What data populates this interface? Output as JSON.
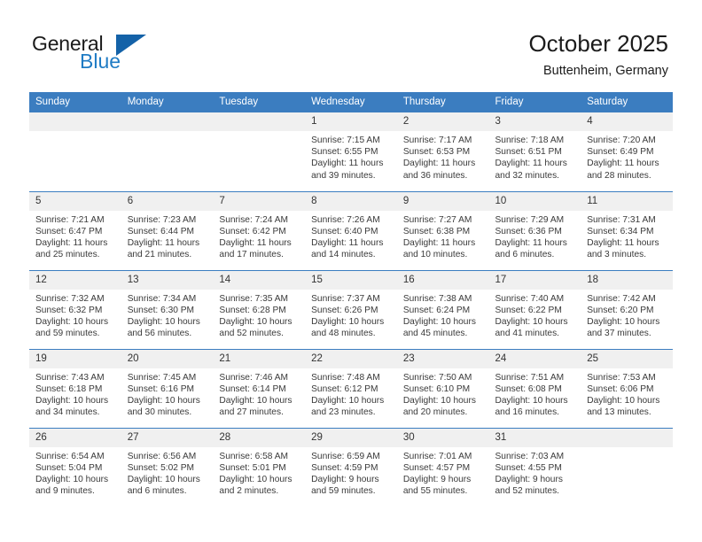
{
  "branding": {
    "logo_text_primary": "General",
    "logo_text_secondary": "Blue",
    "triangle_color": "#1462a8",
    "blue_color": "#1f7bc4"
  },
  "header": {
    "month_title": "October 2025",
    "location": "Buttenheim, Germany"
  },
  "theme": {
    "header_bg": "#3b7dc0",
    "header_text": "#ffffff",
    "daynum_bg": "#f0f0f0",
    "cell_bg": "#ffffff",
    "body_text": "#3a3a3a"
  },
  "weekdays": [
    "Sunday",
    "Monday",
    "Tuesday",
    "Wednesday",
    "Thursday",
    "Friday",
    "Saturday"
  ],
  "labels": {
    "sunrise_prefix": "Sunrise:",
    "sunset_prefix": "Sunset:",
    "daylight_prefix": "Daylight:"
  },
  "weeks": [
    [
      {
        "day": "",
        "empty": true,
        "l1": "",
        "l2": "",
        "l3": "",
        "l4": ""
      },
      {
        "day": "",
        "empty": true,
        "l1": "",
        "l2": "",
        "l3": "",
        "l4": ""
      },
      {
        "day": "",
        "empty": true,
        "l1": "",
        "l2": "",
        "l3": "",
        "l4": ""
      },
      {
        "day": "1",
        "empty": false,
        "l1": "Sunrise: 7:15 AM",
        "l2": "Sunset: 6:55 PM",
        "l3": "Daylight: 11 hours",
        "l4": "and 39 minutes."
      },
      {
        "day": "2",
        "empty": false,
        "l1": "Sunrise: 7:17 AM",
        "l2": "Sunset: 6:53 PM",
        "l3": "Daylight: 11 hours",
        "l4": "and 36 minutes."
      },
      {
        "day": "3",
        "empty": false,
        "l1": "Sunrise: 7:18 AM",
        "l2": "Sunset: 6:51 PM",
        "l3": "Daylight: 11 hours",
        "l4": "and 32 minutes."
      },
      {
        "day": "4",
        "empty": false,
        "l1": "Sunrise: 7:20 AM",
        "l2": "Sunset: 6:49 PM",
        "l3": "Daylight: 11 hours",
        "l4": "and 28 minutes."
      }
    ],
    [
      {
        "day": "5",
        "empty": false,
        "l1": "Sunrise: 7:21 AM",
        "l2": "Sunset: 6:47 PM",
        "l3": "Daylight: 11 hours",
        "l4": "and 25 minutes."
      },
      {
        "day": "6",
        "empty": false,
        "l1": "Sunrise: 7:23 AM",
        "l2": "Sunset: 6:44 PM",
        "l3": "Daylight: 11 hours",
        "l4": "and 21 minutes."
      },
      {
        "day": "7",
        "empty": false,
        "l1": "Sunrise: 7:24 AM",
        "l2": "Sunset: 6:42 PM",
        "l3": "Daylight: 11 hours",
        "l4": "and 17 minutes."
      },
      {
        "day": "8",
        "empty": false,
        "l1": "Sunrise: 7:26 AM",
        "l2": "Sunset: 6:40 PM",
        "l3": "Daylight: 11 hours",
        "l4": "and 14 minutes."
      },
      {
        "day": "9",
        "empty": false,
        "l1": "Sunrise: 7:27 AM",
        "l2": "Sunset: 6:38 PM",
        "l3": "Daylight: 11 hours",
        "l4": "and 10 minutes."
      },
      {
        "day": "10",
        "empty": false,
        "l1": "Sunrise: 7:29 AM",
        "l2": "Sunset: 6:36 PM",
        "l3": "Daylight: 11 hours",
        "l4": "and 6 minutes."
      },
      {
        "day": "11",
        "empty": false,
        "l1": "Sunrise: 7:31 AM",
        "l2": "Sunset: 6:34 PM",
        "l3": "Daylight: 11 hours",
        "l4": "and 3 minutes."
      }
    ],
    [
      {
        "day": "12",
        "empty": false,
        "l1": "Sunrise: 7:32 AM",
        "l2": "Sunset: 6:32 PM",
        "l3": "Daylight: 10 hours",
        "l4": "and 59 minutes."
      },
      {
        "day": "13",
        "empty": false,
        "l1": "Sunrise: 7:34 AM",
        "l2": "Sunset: 6:30 PM",
        "l3": "Daylight: 10 hours",
        "l4": "and 56 minutes."
      },
      {
        "day": "14",
        "empty": false,
        "l1": "Sunrise: 7:35 AM",
        "l2": "Sunset: 6:28 PM",
        "l3": "Daylight: 10 hours",
        "l4": "and 52 minutes."
      },
      {
        "day": "15",
        "empty": false,
        "l1": "Sunrise: 7:37 AM",
        "l2": "Sunset: 6:26 PM",
        "l3": "Daylight: 10 hours",
        "l4": "and 48 minutes."
      },
      {
        "day": "16",
        "empty": false,
        "l1": "Sunrise: 7:38 AM",
        "l2": "Sunset: 6:24 PM",
        "l3": "Daylight: 10 hours",
        "l4": "and 45 minutes."
      },
      {
        "day": "17",
        "empty": false,
        "l1": "Sunrise: 7:40 AM",
        "l2": "Sunset: 6:22 PM",
        "l3": "Daylight: 10 hours",
        "l4": "and 41 minutes."
      },
      {
        "day": "18",
        "empty": false,
        "l1": "Sunrise: 7:42 AM",
        "l2": "Sunset: 6:20 PM",
        "l3": "Daylight: 10 hours",
        "l4": "and 37 minutes."
      }
    ],
    [
      {
        "day": "19",
        "empty": false,
        "l1": "Sunrise: 7:43 AM",
        "l2": "Sunset: 6:18 PM",
        "l3": "Daylight: 10 hours",
        "l4": "and 34 minutes."
      },
      {
        "day": "20",
        "empty": false,
        "l1": "Sunrise: 7:45 AM",
        "l2": "Sunset: 6:16 PM",
        "l3": "Daylight: 10 hours",
        "l4": "and 30 minutes."
      },
      {
        "day": "21",
        "empty": false,
        "l1": "Sunrise: 7:46 AM",
        "l2": "Sunset: 6:14 PM",
        "l3": "Daylight: 10 hours",
        "l4": "and 27 minutes."
      },
      {
        "day": "22",
        "empty": false,
        "l1": "Sunrise: 7:48 AM",
        "l2": "Sunset: 6:12 PM",
        "l3": "Daylight: 10 hours",
        "l4": "and 23 minutes."
      },
      {
        "day": "23",
        "empty": false,
        "l1": "Sunrise: 7:50 AM",
        "l2": "Sunset: 6:10 PM",
        "l3": "Daylight: 10 hours",
        "l4": "and 20 minutes."
      },
      {
        "day": "24",
        "empty": false,
        "l1": "Sunrise: 7:51 AM",
        "l2": "Sunset: 6:08 PM",
        "l3": "Daylight: 10 hours",
        "l4": "and 16 minutes."
      },
      {
        "day": "25",
        "empty": false,
        "l1": "Sunrise: 7:53 AM",
        "l2": "Sunset: 6:06 PM",
        "l3": "Daylight: 10 hours",
        "l4": "and 13 minutes."
      }
    ],
    [
      {
        "day": "26",
        "empty": false,
        "l1": "Sunrise: 6:54 AM",
        "l2": "Sunset: 5:04 PM",
        "l3": "Daylight: 10 hours",
        "l4": "and 9 minutes."
      },
      {
        "day": "27",
        "empty": false,
        "l1": "Sunrise: 6:56 AM",
        "l2": "Sunset: 5:02 PM",
        "l3": "Daylight: 10 hours",
        "l4": "and 6 minutes."
      },
      {
        "day": "28",
        "empty": false,
        "l1": "Sunrise: 6:58 AM",
        "l2": "Sunset: 5:01 PM",
        "l3": "Daylight: 10 hours",
        "l4": "and 2 minutes."
      },
      {
        "day": "29",
        "empty": false,
        "l1": "Sunrise: 6:59 AM",
        "l2": "Sunset: 4:59 PM",
        "l3": "Daylight: 9 hours",
        "l4": "and 59 minutes."
      },
      {
        "day": "30",
        "empty": false,
        "l1": "Sunrise: 7:01 AM",
        "l2": "Sunset: 4:57 PM",
        "l3": "Daylight: 9 hours",
        "l4": "and 55 minutes."
      },
      {
        "day": "31",
        "empty": false,
        "l1": "Sunrise: 7:03 AM",
        "l2": "Sunset: 4:55 PM",
        "l3": "Daylight: 9 hours",
        "l4": "and 52 minutes."
      },
      {
        "day": "",
        "empty": true,
        "l1": "",
        "l2": "",
        "l3": "",
        "l4": ""
      }
    ]
  ]
}
